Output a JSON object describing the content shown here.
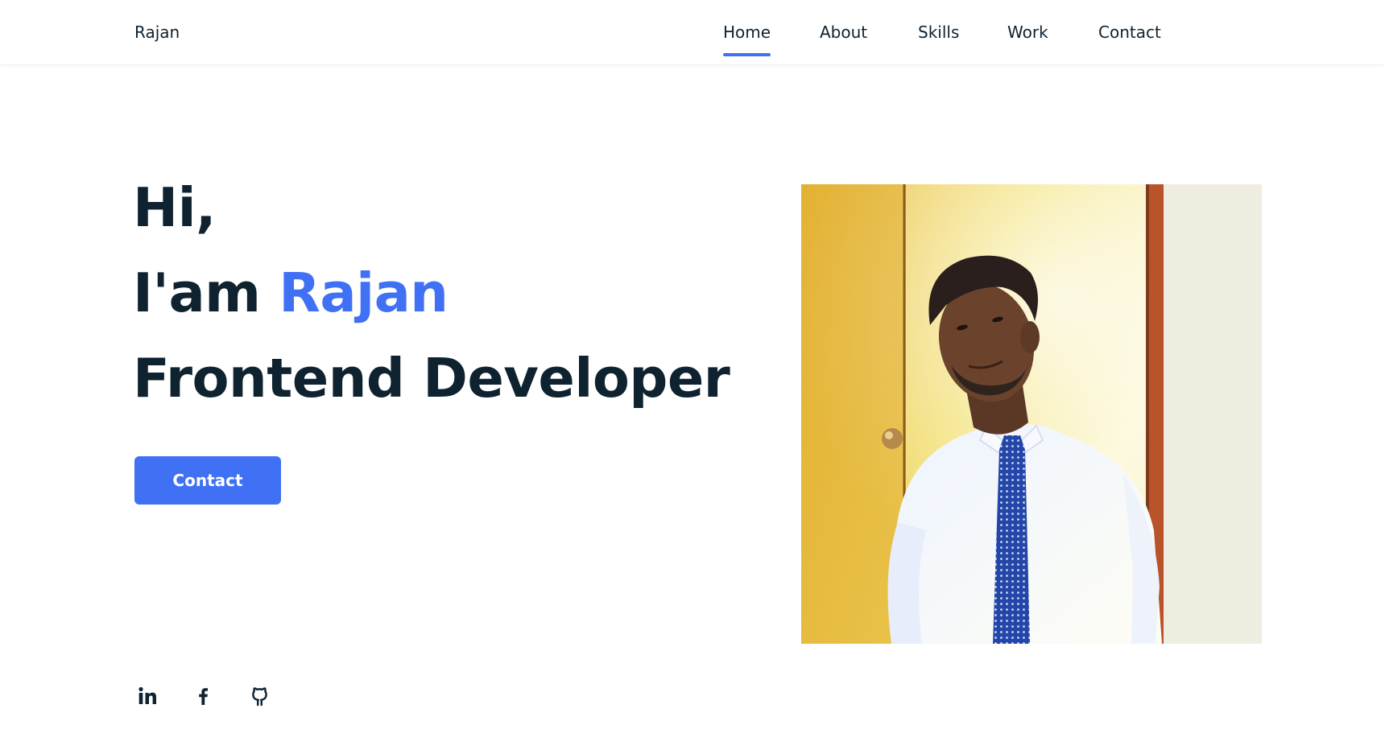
{
  "header": {
    "brand": "Rajan",
    "nav": [
      {
        "label": "Home",
        "active": true
      },
      {
        "label": "About",
        "active": false
      },
      {
        "label": "Skills",
        "active": false
      },
      {
        "label": "Work",
        "active": false
      },
      {
        "label": "Contact",
        "active": false
      }
    ]
  },
  "hero": {
    "greeting": "Hi,",
    "intro_prefix": "I'am",
    "name": "Rajan",
    "role": "Frontend Developer",
    "cta_label": "Contact"
  },
  "social": [
    {
      "icon": "linkedin-icon",
      "label": "in"
    },
    {
      "icon": "facebook-icon",
      "label": "f"
    },
    {
      "icon": "github-icon"
    }
  ],
  "colors": {
    "accent": "#4070f4",
    "text": "#0f2230",
    "background": "#ffffff"
  }
}
